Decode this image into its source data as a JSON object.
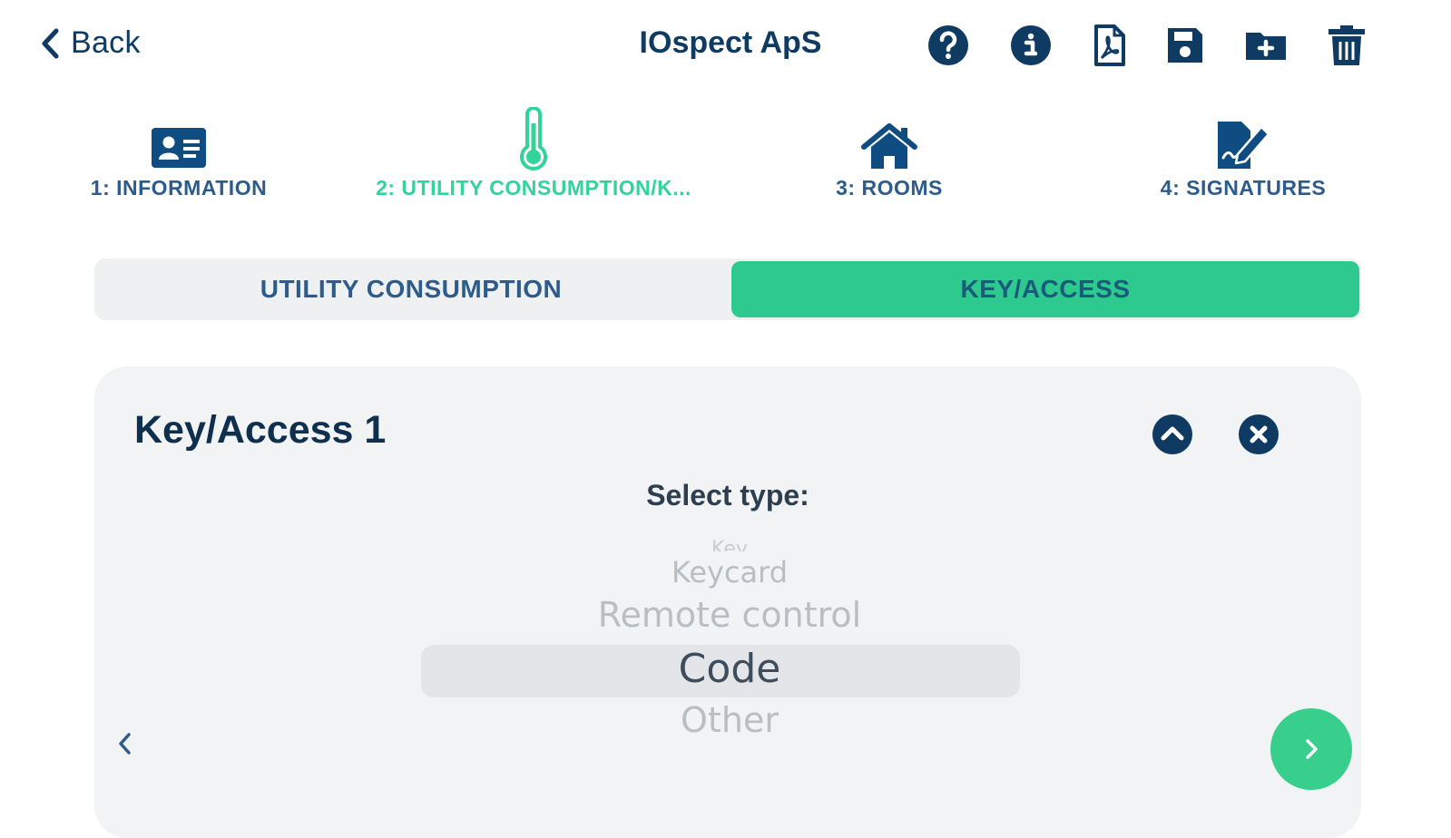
{
  "header": {
    "back_label": "Back",
    "title": "IOspect ApS",
    "icons": [
      "help-icon",
      "info-icon",
      "pdf-icon",
      "save-icon",
      "folder-add-icon",
      "trash-icon"
    ]
  },
  "steps": [
    {
      "label": "1: INFORMATION",
      "icon": "id-card-icon"
    },
    {
      "label": "2: UTILITY CONSUMPTION/K...",
      "icon": "thermometer-icon",
      "active": true
    },
    {
      "label": "3: ROOMS",
      "icon": "home-icon"
    },
    {
      "label": "4: SIGNATURES",
      "icon": "signature-icon"
    }
  ],
  "segment": {
    "left": "UTILITY CONSUMPTION",
    "right": "KEY/ACCESS",
    "selected": "KEY/ACCESS"
  },
  "card": {
    "title": "Key/Access 1",
    "select_label": "Select type:",
    "options": [
      "Key",
      "Keycard",
      "Remote control",
      "Code",
      "Other"
    ],
    "selected": "Code"
  },
  "colors": {
    "primary": "#0f3b63",
    "accent": "#2ec98f",
    "card_bg": "#f1f3f5"
  }
}
